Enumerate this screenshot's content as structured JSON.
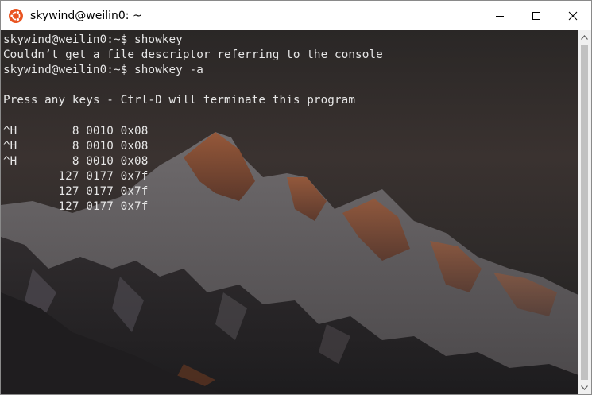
{
  "window": {
    "title": "skywind@weilin0: ~"
  },
  "titlebar": {
    "app_icon": "ubuntu-logo-icon",
    "buttons": [
      "minimize-icon",
      "maximize-icon",
      "close-icon"
    ]
  },
  "terminal": {
    "lines": [
      "skywind@weilin0:~$ showkey",
      "Couldn’t get a file descriptor referring to the console",
      "skywind@weilin0:~$ showkey -a",
      "",
      "Press any keys - Ctrl-D will terminate this program",
      "",
      "^H        8 0010 0x08",
      "^H        8 0010 0x08",
      "^H        8 0010 0x08",
      "        127 0177 0x7f",
      "        127 0177 0x7f",
      "        127 0177 0x7f"
    ],
    "foreground": "#e6e6e6",
    "background": "#2c2a2a"
  },
  "colors": {
    "ubuntu_orange": "#e95420",
    "scrollbar_track": "#f0f0f0",
    "scrollbar_thumb": "#c1c1c1"
  }
}
